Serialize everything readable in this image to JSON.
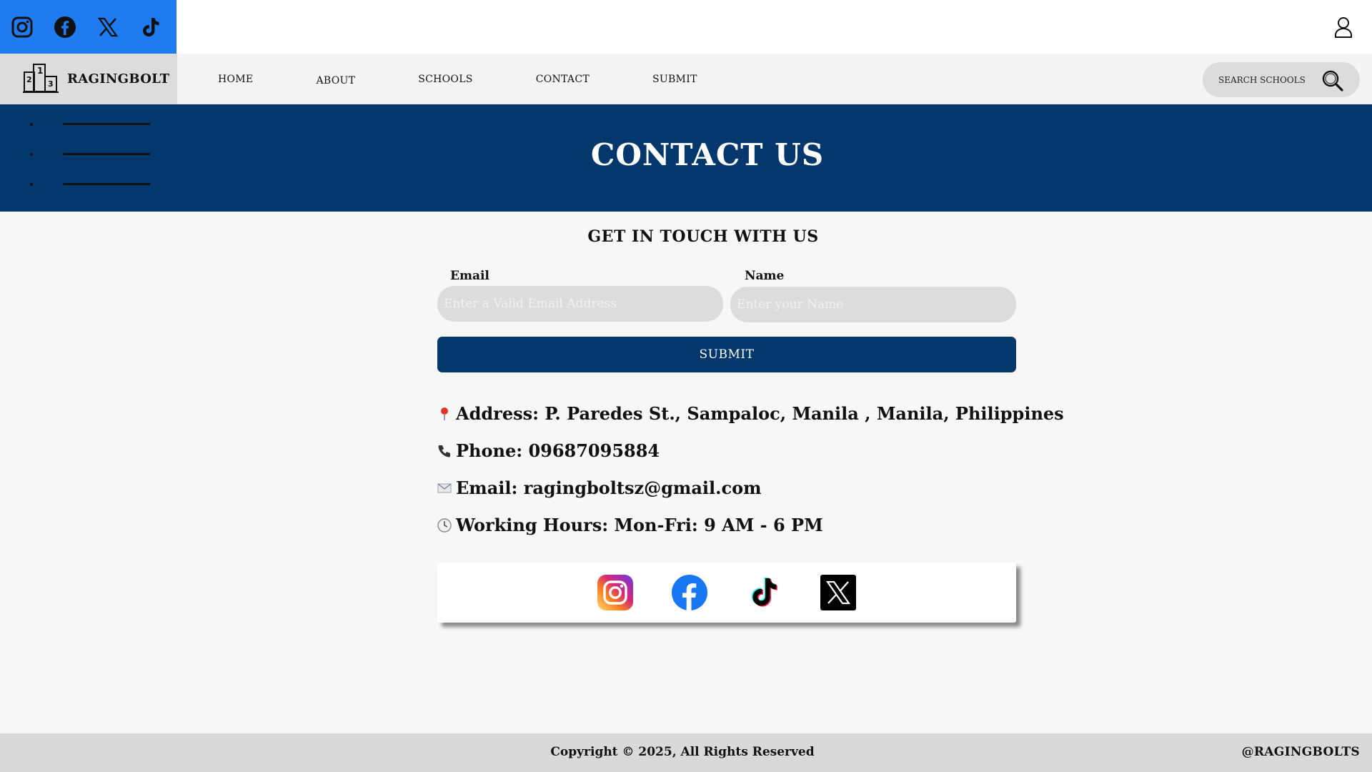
{
  "topbar": {
    "social_icons": [
      "instagram-icon",
      "facebook-icon",
      "x-icon",
      "tiktok-icon"
    ],
    "account_icon": "user-icon",
    "social_bg_color": "#1f7cf0"
  },
  "nav": {
    "brand": "RAGINGBOLT",
    "links": [
      "HOME",
      "ABOUT",
      "SCHOOLS",
      "CONTACT",
      "SUBMIT"
    ],
    "search_placeholder": "SEARCH SCHOOLS",
    "search_icon": "search-icon"
  },
  "hero": {
    "title": "CONTACT US",
    "bg_color": "#04376b"
  },
  "form": {
    "heading": "GET IN TOUCH WITH US",
    "email_label": "Email",
    "email_placeholder": "Enter a Valid Email Address",
    "email_value": "",
    "name_label": "Name",
    "name_placeholder": "Enter your Name",
    "name_value": "",
    "submit_label": "SUBMIT"
  },
  "contact_info": {
    "address": "Address: P. Paredes St., Sampaloc, Manila , Manila, Philippines",
    "phone": "Phone: 09687095884",
    "email": "Email: ragingboltsz@gmail.com",
    "hours": "Working Hours: Mon-Fri: 9 AM - 6 PM"
  },
  "social_card_icons": [
    "instagram-icon",
    "facebook-icon",
    "tiktok-icon",
    "x-icon"
  ],
  "footer": {
    "copyright": "Copyright © 2025, All Rights Reserved",
    "handle": "@RAGINGBOLTS"
  }
}
